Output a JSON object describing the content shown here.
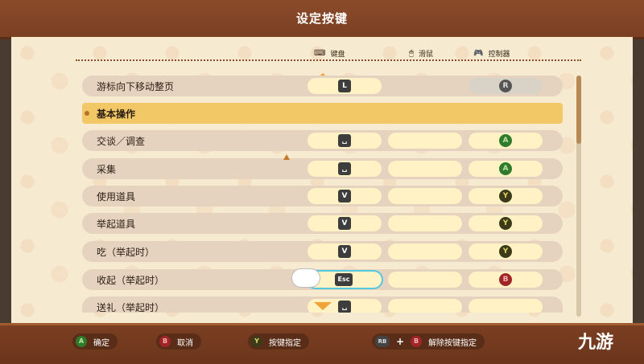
{
  "title": "设定按键",
  "headers": {
    "keyboard": "键盘",
    "mouse": "滑鼠",
    "controller": "控制器",
    "keyboard_icon": "keyboard-icon",
    "mouse_icon": "mouse-icon",
    "controller_icon": "controller-icon"
  },
  "top_row": {
    "label": "游标向下移动整页",
    "key": "L",
    "pad": "R"
  },
  "section": {
    "label": "基本操作"
  },
  "rows": [
    {
      "label": "交谈／调查",
      "key": "␣",
      "pad": "A"
    },
    {
      "label": "采集",
      "key": "␣",
      "pad": "A"
    },
    {
      "label": "使用道具",
      "key": "V",
      "pad": "Y"
    },
    {
      "label": "举起道具",
      "key": "V",
      "pad": "Y"
    },
    {
      "label": "吃（举起时）",
      "key": "V",
      "pad": "Y"
    },
    {
      "label": "收起（举起时）",
      "key": "Esc",
      "pad": "B"
    },
    {
      "label": "送礼（举起时）",
      "key": "␣",
      "pad": ""
    }
  ],
  "footer": {
    "confirm": {
      "glyph": "A",
      "label": "确定"
    },
    "cancel": {
      "glyph": "B",
      "label": "取消"
    },
    "assign": {
      "glyph": "Y",
      "label": "按键指定"
    },
    "unassign": {
      "glyph1": "RB",
      "glyph2": "B",
      "label": "解除按键指定"
    }
  },
  "watermark": "九游",
  "colors": {
    "header_bg": "#8a4b2a",
    "panel_bg": "#f6ead0",
    "row_bg": "#e6d3bf",
    "cell_bg": "#fff3c5",
    "section_bg": "#f2c866",
    "selection": "#55c7df"
  }
}
